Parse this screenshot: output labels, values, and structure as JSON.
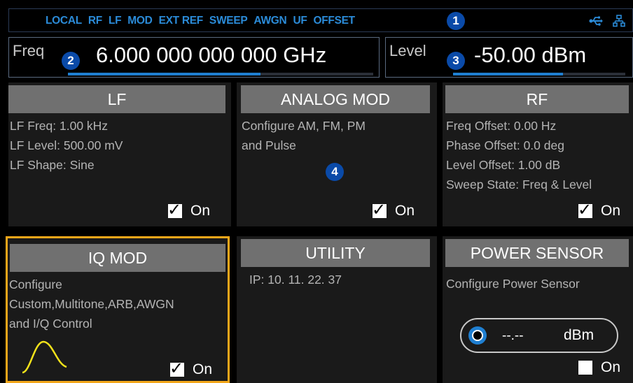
{
  "status_bar": {
    "items": [
      "LOCAL",
      "RF",
      "LF",
      "MOD",
      "EXT REF",
      "SWEEP",
      "AWGN",
      "UF",
      "OFFSET"
    ],
    "icons": [
      "usb-icon",
      "network-icon"
    ],
    "accent": "#2b8bd8"
  },
  "callouts": [
    "1",
    "2",
    "3",
    "4"
  ],
  "frequency": {
    "label": "Freq",
    "value": "6.000 000 000 000  GHz",
    "slider_level": 0.63
  },
  "level": {
    "label": "Level",
    "value": "-50.00  dBm",
    "slider_level": 0.64
  },
  "tiles": {
    "lf": {
      "title": "LF",
      "lines": [
        "LF Freq: 1.00 kHz",
        "LF Level: 500.00 mV",
        "LF Shape: Sine"
      ],
      "toggle_label": "On",
      "checked": true
    },
    "analog_mod": {
      "title": "ANALOG MOD",
      "lines": [
        "Configure AM, FM, PM",
        "and Pulse"
      ],
      "toggle_label": "On",
      "checked": true
    },
    "rf": {
      "title": "RF",
      "lines": [
        "Freq Offset: 0.00 Hz",
        "Phase Offset: 0.0 deg",
        "Level Offset: 1.00 dB",
        "Sweep State: Freq & Level"
      ],
      "toggle_label": "On",
      "checked": true
    },
    "iq_mod": {
      "title": "IQ MOD",
      "lines": [
        "Configure",
        "Custom,Multitone,ARB,AWGN",
        "and I/Q Control"
      ],
      "toggle_label": "On",
      "checked": true,
      "selected_color": "#f2a61a"
    },
    "utility": {
      "title": "UTILITY",
      "lines": [
        "IP:  10. 11. 22. 37"
      ]
    },
    "power_sensor": {
      "title": "POWER SENSOR",
      "lines": [
        "Configure Power Sensor"
      ],
      "reading": "--.--",
      "unit": "dBm",
      "toggle_label": "On",
      "checked": false
    }
  }
}
